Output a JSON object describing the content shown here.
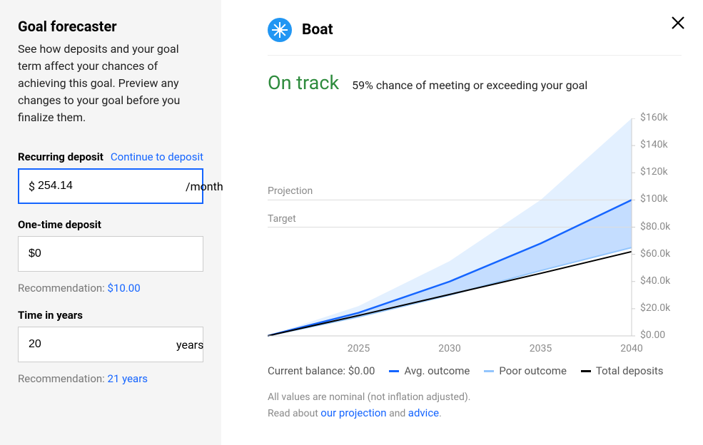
{
  "sidebar": {
    "title": "Goal forecaster",
    "subtitle": "See how deposits and your goal term affect your chances of achieving this goal. Preview any changes to your goal before you finalize them.",
    "recurring": {
      "label": "Recurring deposit",
      "link": "Continue to deposit",
      "prefix": "$",
      "value": "254.14",
      "suffix": "/month"
    },
    "onetime": {
      "label": "One-time deposit",
      "value": "$0",
      "recommendation_label": "Recommendation: ",
      "recommendation_value": "$10.00"
    },
    "time": {
      "label": "Time in years",
      "value": "20",
      "suffix": "years",
      "recommendation_label": "Recommendation: ",
      "recommendation_value": "21 years"
    }
  },
  "main": {
    "goal_name": "Boat",
    "status": "On track",
    "status_desc": "59% chance of meeting or exceeding your goal",
    "projection_label": "Projection",
    "target_label": "Target",
    "current_balance_label": "Current balance: $0.00",
    "legend": {
      "avg": "Avg. outcome",
      "poor": "Poor outcome",
      "total": "Total deposits"
    },
    "footnote_a": "All values are nominal (not inflation adjusted).",
    "footnote_b_pre": "Read about ",
    "footnote_b_link1": "our projection",
    "footnote_b_mid": " and ",
    "footnote_b_link2": "advice",
    "footnote_b_post": "."
  },
  "chart_data": {
    "type": "line",
    "x_range": [
      2020,
      2040
    ],
    "x_ticks": [
      2025,
      2030,
      2035,
      2040
    ],
    "y_range": [
      0,
      160000
    ],
    "y_ticks": [
      0,
      20000,
      40000,
      60000,
      80000,
      100000,
      120000,
      140000,
      160000
    ],
    "y_tick_labels": [
      "$0.00",
      "$20.0k",
      "$40.0k",
      "$60.0k",
      "$80.0k",
      "$100k",
      "$120k",
      "$140k",
      "$160k"
    ],
    "target_line": 80000,
    "projection_line": 100000,
    "series": [
      {
        "name": "Total deposits",
        "color": "#000000",
        "x": [
          2020,
          2025,
          2030,
          2035,
          2040
        ],
        "y": [
          0,
          15000,
          30500,
          46000,
          62000
        ]
      },
      {
        "name": "Avg. outcome",
        "color": "#1565ff",
        "x": [
          2020,
          2025,
          2030,
          2035,
          2040
        ],
        "y": [
          0,
          17000,
          40000,
          68000,
          100000
        ]
      },
      {
        "name": "Poor outcome",
        "color": "#93c5fd",
        "x": [
          2020,
          2025,
          2030,
          2035,
          2040
        ],
        "y": [
          0,
          14000,
          30000,
          48000,
          65000
        ]
      },
      {
        "name": "Upper band",
        "color": "#cfe6ff",
        "x": [
          2020,
          2025,
          2030,
          2035,
          2040
        ],
        "y": [
          0,
          22000,
          55000,
          100000,
          160000
        ]
      }
    ]
  }
}
